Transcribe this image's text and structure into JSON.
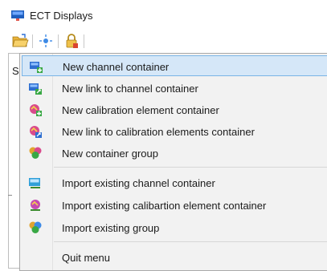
{
  "window": {
    "title": "ECT Displays",
    "icon": "app-monitor-icon"
  },
  "toolbar": {
    "buttons": [
      {
        "icon": "open-folder-icon"
      },
      {
        "icon": "sparkle-icon"
      },
      {
        "icon": "lock-icon"
      }
    ]
  },
  "background": {
    "panel_label_fragment": "S"
  },
  "context_menu": {
    "items": [
      {
        "label": "New channel container",
        "icon": "new-channel-container-icon",
        "selected": true
      },
      {
        "label": "New link to channel container",
        "icon": "new-link-channel-container-icon"
      },
      {
        "label": "New calibration element container",
        "icon": "new-calibration-container-icon"
      },
      {
        "label": "New link to calibration elements container",
        "icon": "new-link-calibration-container-icon"
      },
      {
        "label": "New container group",
        "icon": "new-container-group-icon"
      },
      {
        "label": "Import existing channel container",
        "icon": "import-channel-container-icon"
      },
      {
        "label": "Import existing calibartion element container",
        "icon": "import-calibration-container-icon"
      },
      {
        "label": "Import existing group",
        "icon": "import-group-icon"
      },
      {
        "label": "Quit menu",
        "icon": ""
      }
    ]
  },
  "colors": {
    "selection_fill": "#d5e7f8",
    "selection_border": "#7ab4e6",
    "menu_background": "#f2f2f2"
  }
}
